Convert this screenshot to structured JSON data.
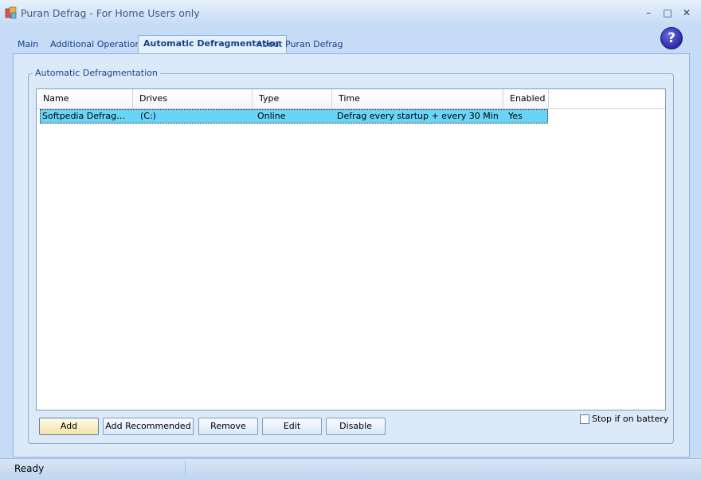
{
  "window": {
    "title": "Puran Defrag - For Home Users only",
    "minimize_glyph": "–",
    "maximize_glyph": "□",
    "close_glyph": "✕"
  },
  "tabs": [
    {
      "label": "Main"
    },
    {
      "label": "Additional Operations"
    },
    {
      "label": "Automatic Defragmentation",
      "active": true
    },
    {
      "label": "About Puran Defrag"
    }
  ],
  "help": {
    "glyph": "?"
  },
  "group": {
    "label": "Automatic Defragmentation"
  },
  "list": {
    "columns": [
      "Name",
      "Drives",
      "Type",
      "Time",
      "Enabled"
    ],
    "rows": [
      {
        "name": "Softpedia Defragme…",
        "drives": "(C:)",
        "type": "Online",
        "time": "Defrag every startup + every 30 Min",
        "enabled": "Yes"
      }
    ]
  },
  "buttons": {
    "add": "Add",
    "add_recommended": "Add Recommended",
    "remove": "Remove",
    "edit": "Edit",
    "disable": "Disable"
  },
  "battery": {
    "label": "Stop if on battery",
    "checked": false
  },
  "status": {
    "text": "Ready"
  },
  "colors": {
    "selection": "#6ad4f6",
    "accent": "#15428b",
    "frame": "#c6dbf5"
  }
}
